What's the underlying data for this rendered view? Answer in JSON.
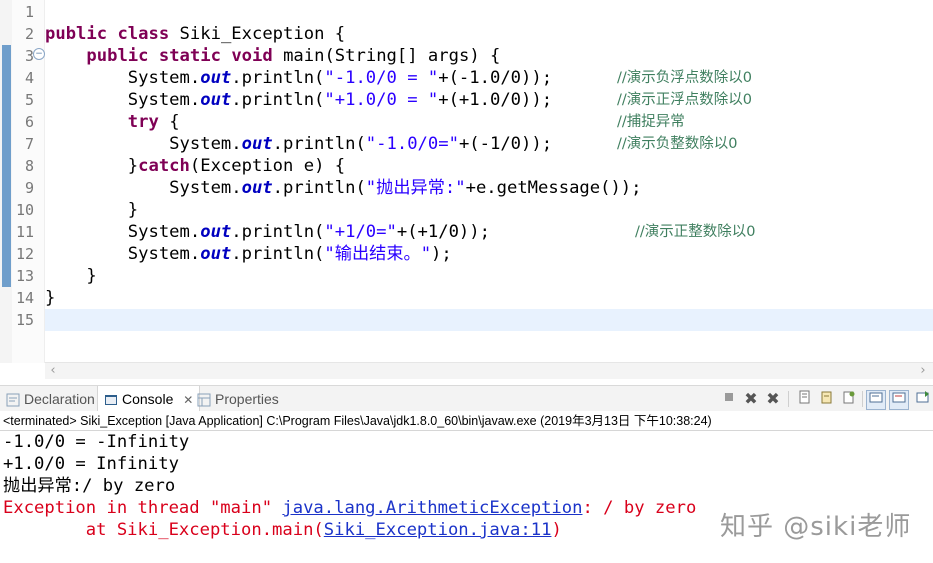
{
  "editor": {
    "line_numbers": [
      "1",
      "2",
      "3",
      "4",
      "5",
      "6",
      "7",
      "8",
      "9",
      "10",
      "11",
      "12",
      "13",
      "14",
      "15"
    ],
    "lines": [
      {
        "tokens": []
      },
      {
        "tokens": [
          {
            "t": "public",
            "c": "kw"
          },
          {
            "t": " "
          },
          {
            "t": "class",
            "c": "kw"
          },
          {
            "t": " Siki_Exception {"
          }
        ]
      },
      {
        "tokens": [
          {
            "t": "    "
          },
          {
            "t": "public",
            "c": "kw"
          },
          {
            "t": " "
          },
          {
            "t": "static",
            "c": "kw"
          },
          {
            "t": " "
          },
          {
            "t": "void",
            "c": "kw"
          },
          {
            "t": " main(String[] args) {"
          }
        ]
      },
      {
        "tokens": [
          {
            "t": "        System."
          },
          {
            "t": "out",
            "c": "fld"
          },
          {
            "t": ".println("
          },
          {
            "t": "\"-1.0/0 = \"",
            "c": "str"
          },
          {
            "t": "+(-1.0/0));"
          }
        ],
        "comment": "//演示负浮点数除以0"
      },
      {
        "tokens": [
          {
            "t": "        System."
          },
          {
            "t": "out",
            "c": "fld"
          },
          {
            "t": ".println("
          },
          {
            "t": "\"+1.0/0 = \"",
            "c": "str"
          },
          {
            "t": "+(+1.0/0));"
          }
        ],
        "comment": "//演示正浮点数除以0"
      },
      {
        "tokens": [
          {
            "t": "        "
          },
          {
            "t": "try",
            "c": "kw"
          },
          {
            "t": " {"
          }
        ],
        "comment": "//捕捉异常"
      },
      {
        "tokens": [
          {
            "t": "            System."
          },
          {
            "t": "out",
            "c": "fld"
          },
          {
            "t": ".println("
          },
          {
            "t": "\"-1.0/0=\"",
            "c": "str"
          },
          {
            "t": "+(-1/0));"
          }
        ],
        "comment": "//演示负整数除以0"
      },
      {
        "tokens": [
          {
            "t": "        }"
          },
          {
            "t": "catch",
            "c": "kw"
          },
          {
            "t": "(Exception e) {"
          }
        ]
      },
      {
        "tokens": [
          {
            "t": "            System."
          },
          {
            "t": "out",
            "c": "fld"
          },
          {
            "t": ".println("
          },
          {
            "t": "\"抛出异常:\"",
            "c": "str"
          },
          {
            "t": "+e.getMessage());"
          }
        ]
      },
      {
        "tokens": [
          {
            "t": "        }"
          }
        ]
      },
      {
        "tokens": [
          {
            "t": "        System."
          },
          {
            "t": "out",
            "c": "fld"
          },
          {
            "t": ".println("
          },
          {
            "t": "\"+1/0=\"",
            "c": "str"
          },
          {
            "t": "+(+1/0));"
          }
        ],
        "comment": "//演示正整数除以0"
      },
      {
        "tokens": [
          {
            "t": "        System."
          },
          {
            "t": "out",
            "c": "fld"
          },
          {
            "t": ".println("
          },
          {
            "t": "\"输出结束。\"",
            "c": "str"
          },
          {
            "t": ");"
          }
        ]
      },
      {
        "tokens": [
          {
            "t": "    }"
          }
        ]
      },
      {
        "tokens": [
          {
            "t": "}"
          }
        ]
      },
      {
        "tokens": []
      }
    ]
  },
  "views": {
    "tabs": [
      {
        "label": "Declaration",
        "icon": "declaration-icon",
        "active": false
      },
      {
        "label": "Console",
        "icon": "console-icon",
        "active": true,
        "close": "✕"
      },
      {
        "label": "Properties",
        "icon": "properties-icon",
        "active": false
      }
    ],
    "toolbar_icons": [
      "terminate-icon",
      "remove-launch-icon",
      "remove-all-terminated-icon",
      "scroll-lock-icon",
      "clear-console-icon",
      "pin-console-icon",
      "word-wrap-icon",
      "show-on-stdout-icon",
      "show-on-stderr-icon",
      "open-console-icon"
    ]
  },
  "console": {
    "status": "<terminated> Siki_Exception [Java Application] C:\\Program Files\\Java\\jdk1.8.0_60\\bin\\javaw.exe (2019年3月13日 下午10:38:24)",
    "output": [
      {
        "text": "-1.0/0 = -Infinity",
        "kind": "out"
      },
      {
        "text": "+1.0/0 = Infinity",
        "kind": "out"
      },
      {
        "text": "抛出异常:/ by zero",
        "kind": "out"
      },
      {
        "parts": [
          {
            "t": "Exception in thread \"main\" "
          },
          {
            "t": "java.lang.ArithmeticException",
            "link": true
          },
          {
            "t": ": / by zero"
          }
        ],
        "kind": "err"
      },
      {
        "parts": [
          {
            "t": "        at Siki_Exception.main("
          },
          {
            "t": "Siki_Exception.java:11",
            "link": true
          },
          {
            "t": ")"
          }
        ],
        "kind": "err"
      }
    ]
  },
  "watermark": "知乎 @siki老师",
  "colors": {
    "keyword": "#7f0055",
    "field": "#0000c0",
    "string": "#2a00ff",
    "comment": "#3f7f5f",
    "error": "#d9001b",
    "link": "#1b33c9",
    "current_line": "#e8f2fe"
  }
}
